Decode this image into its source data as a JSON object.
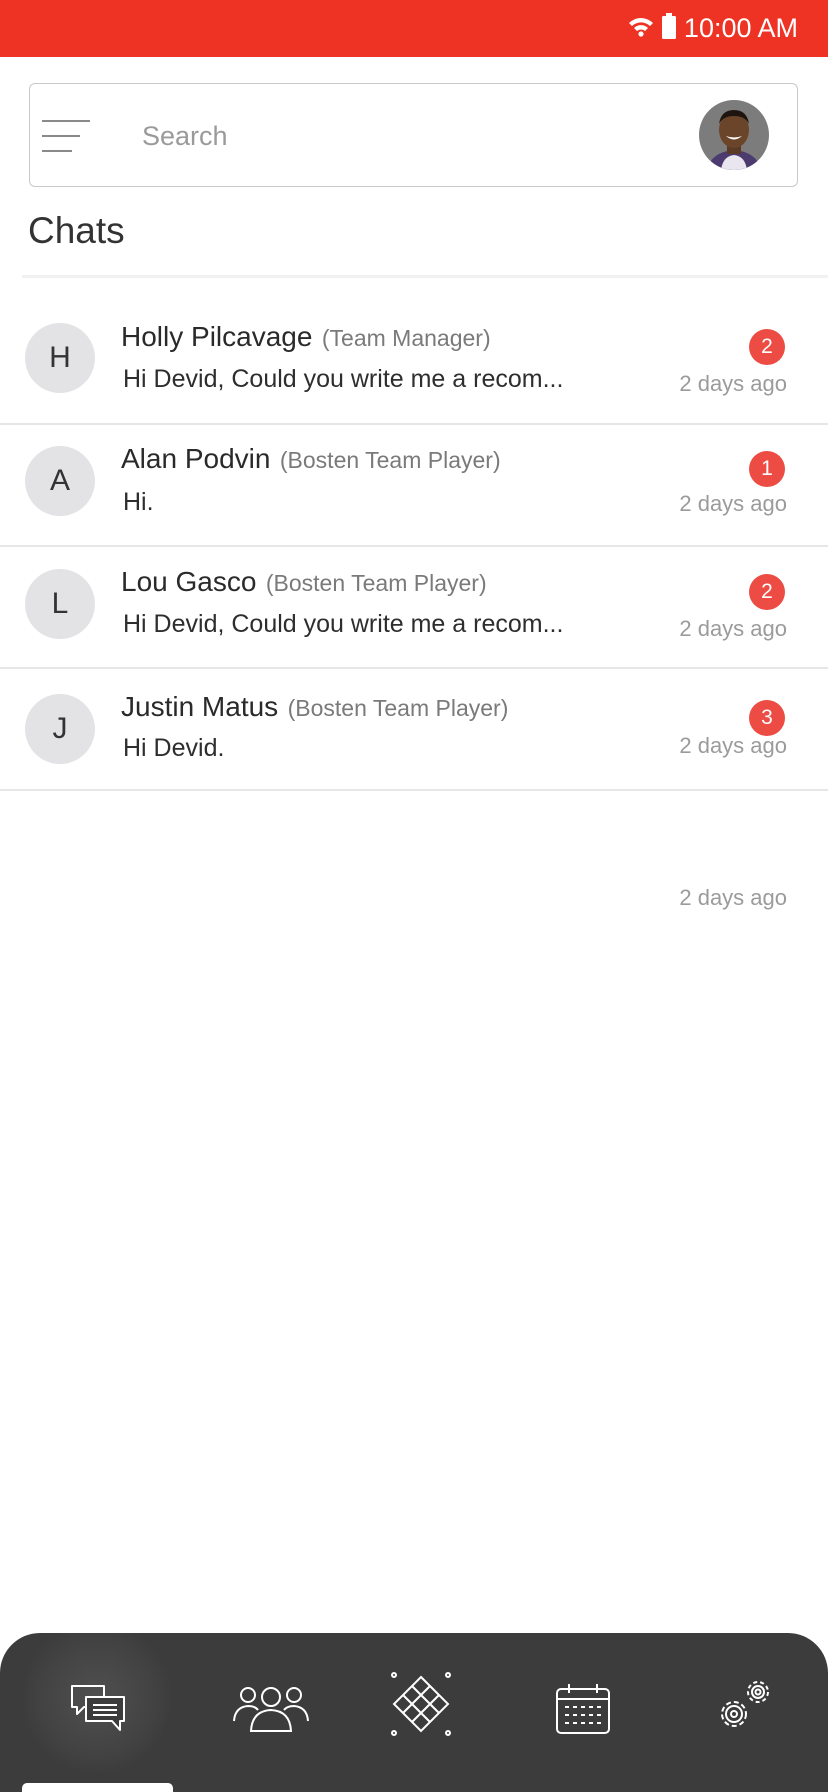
{
  "status_bar": {
    "time": "10:00 AM",
    "background": "#ee3325"
  },
  "search": {
    "placeholder": "Search"
  },
  "page_title": "Chats",
  "chats": [
    {
      "initial": "H",
      "name": "Holly Pilcavage",
      "role": "(Team Manager)",
      "preview": "Hi Devid, Could you write me a recom...",
      "unread": "2",
      "time": "2 days ago"
    },
    {
      "initial": "A",
      "name": "Alan Podvin",
      "role": "(Bosten Team Player)",
      "preview": "Hi.",
      "unread": "1",
      "time": "2 days ago"
    },
    {
      "initial": "L",
      "name": "Lou Gasco",
      "role": "(Bosten Team Player)",
      "preview": "Hi Devid, Could you write me a recom...",
      "unread": "2",
      "time": "2 days ago"
    },
    {
      "initial": "J",
      "name": "Justin Matus",
      "role": "(Bosten Team Player)",
      "preview": "Hi Devid.",
      "unread": "3",
      "time": "2 days ago"
    }
  ],
  "orphan_time": "2 days ago",
  "bottom_nav": {
    "items": [
      {
        "icon": "chat-icon",
        "active": true
      },
      {
        "icon": "team-icon",
        "active": false
      },
      {
        "icon": "court-icon",
        "active": false
      },
      {
        "icon": "calendar-icon",
        "active": false
      },
      {
        "icon": "settings-icon",
        "active": false
      }
    ],
    "background": "#3c3c3c"
  },
  "colors": {
    "accent": "#ee3325",
    "badge": "#ed4c44"
  }
}
